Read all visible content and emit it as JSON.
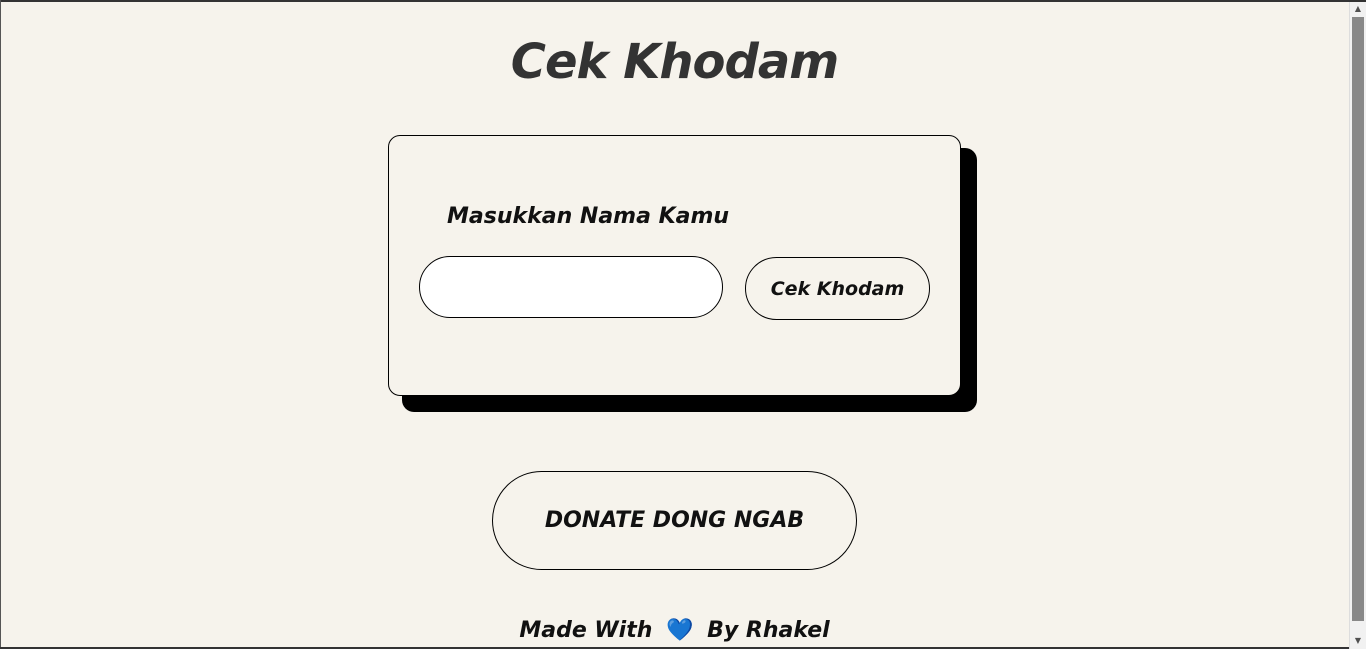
{
  "header": {
    "title": "Cek Khodam"
  },
  "form": {
    "label": "Masukkan Nama Kamu",
    "name_value": "",
    "name_placeholder": "",
    "submit_label": "Cek Khodam"
  },
  "donate": {
    "label": "DONATE DONG NGAB"
  },
  "footer": {
    "prefix": "Made With",
    "heart": "💙",
    "suffix": "By Rhakel"
  },
  "icons": {
    "heart": "blue-heart-icon",
    "scroll_up": "scroll-up-arrow-icon",
    "scroll_down": "scroll-down-arrow-icon"
  },
  "colors": {
    "background": "#f6f3ec",
    "text": "#111111",
    "title": "#333333",
    "shadow": "#000000",
    "heart": "#1f6fd1"
  }
}
